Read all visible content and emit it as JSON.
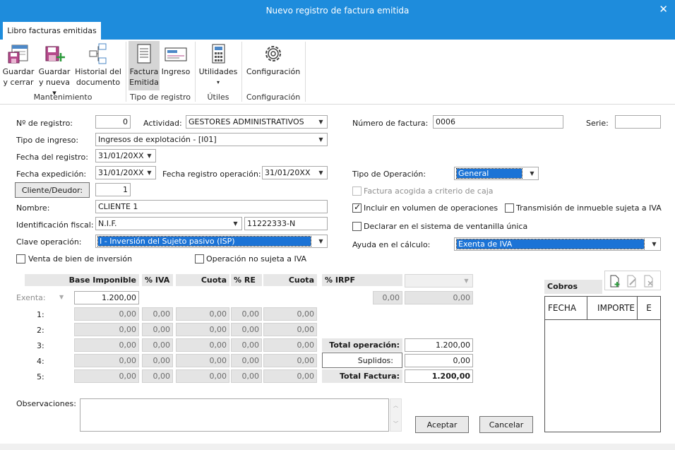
{
  "window": {
    "title": "Nuevo registro de factura emitida",
    "close": "✕"
  },
  "tab": "Libro facturas emitidas",
  "ribbon": {
    "buttons": [
      {
        "line1": "Guardar",
        "line2": "y cerrar"
      },
      {
        "line1": "Guardar",
        "line2": "y nueva ▾"
      },
      {
        "line1": "Historial del",
        "line2": "documento"
      },
      {
        "line1": "Factura",
        "line2": "Emitida"
      },
      {
        "line1": "Ingreso",
        "line2": ""
      },
      {
        "line1": "Utilidades",
        "line2": "▾"
      },
      {
        "line1": "Configuración",
        "line2": ""
      }
    ],
    "groups": [
      "Mantenimiento",
      "Tipo de registro",
      "Útiles",
      "Configuración"
    ]
  },
  "form": {
    "num_registro_label": "Nº de registro:",
    "num_registro": "0",
    "actividad_label": "Actividad:",
    "actividad": "GESTORES ADMINISTRATIVOS",
    "numero_factura_label": "Número de factura:",
    "numero_factura": "0006",
    "serie_label": "Serie:",
    "serie": "",
    "tipo_ingreso_label": "Tipo de ingreso:",
    "tipo_ingreso": "Ingresos de explotación - [I01]",
    "fecha_registro_label": "Fecha del registro:",
    "fecha_registro": "31/01/20XX",
    "fecha_expedicion_label": "Fecha expedición:",
    "fecha_expedicion": "31/01/20XX",
    "fecha_reg_op_label": "Fecha registro operación:",
    "fecha_reg_op": "31/01/20XX",
    "tipo_operacion_label": "Tipo de Operación:",
    "tipo_operacion": "General",
    "cliente_button": "Cliente/Deudor:",
    "cliente_num": "1",
    "factura_caja": "Factura acogida a criterio de caja",
    "nombre_label": "Nombre:",
    "nombre": "CLIENTE 1",
    "incluir_volumen": "Incluir en  volumen de operaciones",
    "transmision_inmueble": "Transmisión de inmueble sujeta a IVA",
    "id_fiscal_label": "Identificación fiscal:",
    "id_fiscal_tipo": "N.I.F.",
    "id_fiscal": "11222333-N",
    "ventanilla_unica": "Declarar en el sistema de ventanilla única",
    "clave_operacion_label": "Clave operación:",
    "clave_operacion": "I - Inversión del Sujeto pasivo (ISP)",
    "ayuda_calculo_label": "Ayuda en el cálculo:",
    "ayuda_calculo": "Exenta de IVA",
    "venta_bien_inversion": "Venta de bien de inversión",
    "operacion_no_sujeta": "Operación no sujeta a IVA"
  },
  "grid": {
    "headers": {
      "base": "Base Imponible",
      "iva": "% IVA",
      "cuota1": "Cuota",
      "re": "% RE",
      "cuota2": "Cuota",
      "irpf": "% IRPF"
    },
    "exenta_label": "Exenta:",
    "exenta_base": "1.200,00",
    "irpf_pct": "0,00",
    "irpf_cuota": "0,00",
    "rows": [
      {
        "label": "1:",
        "base": "0,00",
        "iva": "0,00",
        "cuota1": "0,00",
        "re": "0,00",
        "cuota2": "0,00"
      },
      {
        "label": "2:",
        "base": "0,00",
        "iva": "0,00",
        "cuota1": "0,00",
        "re": "0,00",
        "cuota2": "0,00"
      },
      {
        "label": "3:",
        "base": "0,00",
        "iva": "0,00",
        "cuota1": "0,00",
        "re": "0,00",
        "cuota2": "0,00"
      },
      {
        "label": "4:",
        "base": "0,00",
        "iva": "0,00",
        "cuota1": "0,00",
        "re": "0,00",
        "cuota2": "0,00"
      },
      {
        "label": "5:",
        "base": "0,00",
        "iva": "0,00",
        "cuota1": "0,00",
        "re": "0,00",
        "cuota2": "0,00"
      }
    ],
    "total_operacion_label": "Total operación:",
    "total_operacion": "1.200,00",
    "suplidos_label": "Suplidos:",
    "suplidos": "0,00",
    "total_factura_label": "Total Factura:",
    "total_factura": "1.200,00"
  },
  "cobros": {
    "title": "Cobros",
    "col_fecha": "FECHA",
    "col_importe": "IMPORTE",
    "col_e": "E"
  },
  "observaciones_label": "Observaciones:",
  "observaciones": "",
  "aceptar": "Aceptar",
  "cancelar": "Cancelar"
}
